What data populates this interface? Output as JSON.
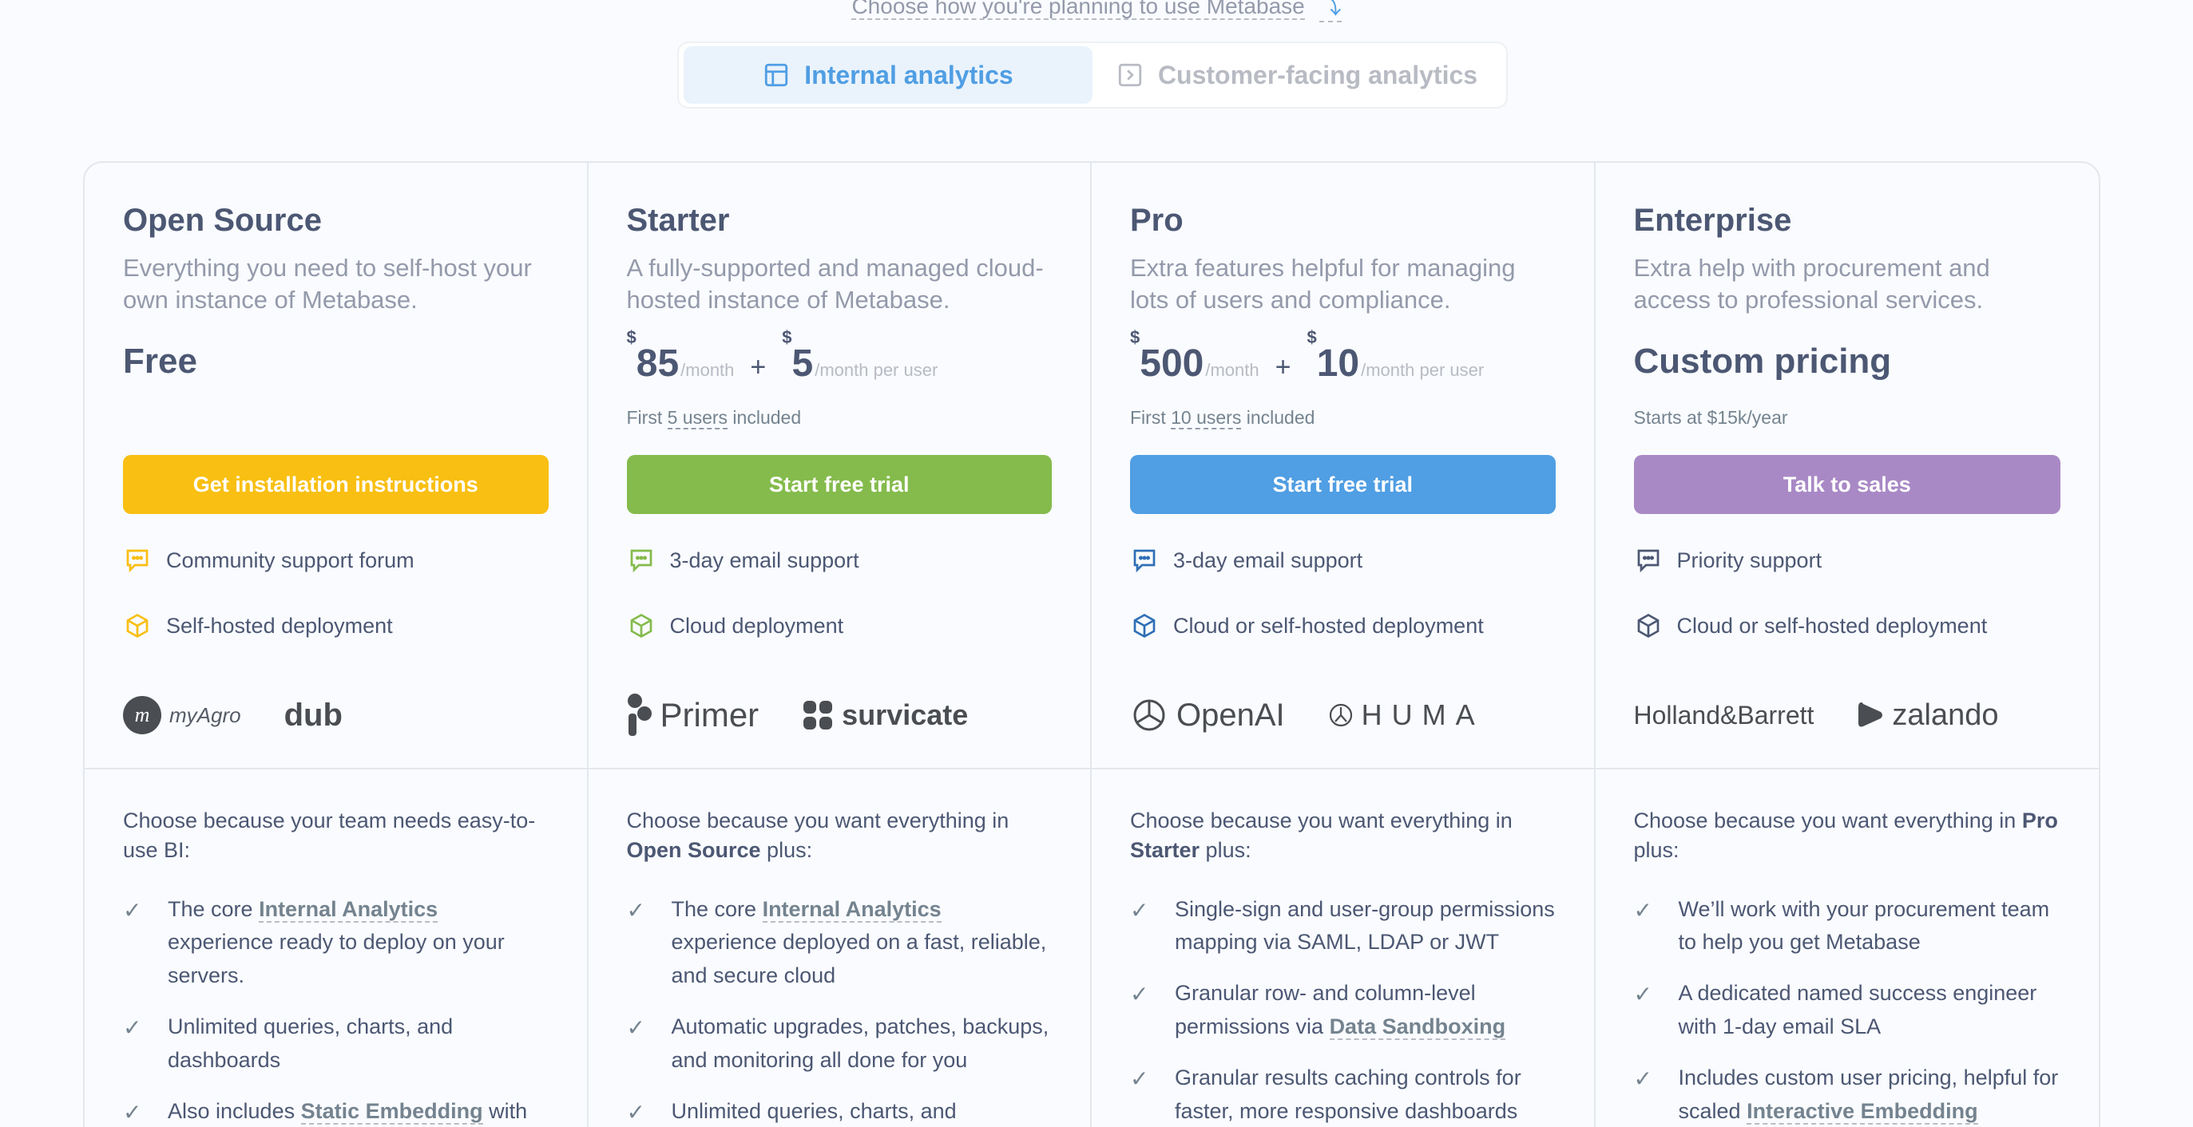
{
  "chooser": {
    "hint": "Choose how you're planning to use Metabase",
    "tabs": [
      {
        "label": "Internal analytics",
        "active": true
      },
      {
        "label": "Customer-facing analytics",
        "active": false
      }
    ]
  },
  "plans": [
    {
      "name": "Open Source",
      "description": "Everything you need to self-host your own instance of Metabase.",
      "price_label": "Free",
      "note": "",
      "cta": "Get installation instructions",
      "accent": "#F9BF12",
      "features": [
        "Community support forum",
        "Self-hosted deployment"
      ],
      "logos": [
        "myAgro",
        "dub"
      ],
      "choose_prefix": "Choose because your team needs easy-to-use BI:",
      "items": [
        {
          "pre": "The core ",
          "link": "Internal Analytics",
          "post": " experience ready to deploy on your servers."
        },
        {
          "pre": "Unlimited queries, charts, and dashboards",
          "link": "",
          "post": ""
        },
        {
          "pre": "Also includes ",
          "link": "Static Embedding",
          "post": " with the “Powered by Metabase” badge."
        }
      ]
    },
    {
      "name": "Starter",
      "description": "A fully-supported and managed cloud-hosted instance of Metabase.",
      "price": {
        "base": "85",
        "base_unit": "/month",
        "per_user": "5",
        "per_user_unit": "/month per user",
        "currency": "$"
      },
      "note": {
        "pre": "First ",
        "link": "5 users",
        "post": " included"
      },
      "cta": "Start free trial",
      "accent": "#84BB4C",
      "features": [
        "3-day email support",
        "Cloud deployment"
      ],
      "logos": [
        "Primer",
        "survicate"
      ],
      "choose_prefix": "Choose because you want everything in ",
      "choose_bold": "Open Source",
      "choose_suffix": " plus:",
      "items": [
        {
          "pre": "The core ",
          "link": "Internal Analytics",
          "post": " experience deployed on a fast, reliable, and secure cloud"
        },
        {
          "pre": "Automatic upgrades, patches, backups, and monitoring all done for you",
          "link": "",
          "post": ""
        },
        {
          "pre": "Unlimited queries, charts, and",
          "link": "",
          "post": ""
        }
      ]
    },
    {
      "name": "Pro",
      "description": "Extra features helpful for managing lots of users and compliance.",
      "price": {
        "base": "500",
        "base_unit": "/month",
        "per_user": "10",
        "per_user_unit": "/month per user",
        "currency": "$"
      },
      "note": {
        "pre": "First ",
        "link": "10 users",
        "post": " included"
      },
      "cta": "Start free trial",
      "accent": "#509EE3",
      "features": [
        "3-day email support",
        "Cloud or self-hosted deployment"
      ],
      "logos": [
        "OpenAI",
        "HUMA"
      ],
      "choose_prefix": "Choose because you want everything in ",
      "choose_bold": "Starter",
      "choose_suffix": " plus:",
      "items": [
        {
          "pre": "Single-sign and user-group permissions mapping via SAML, LDAP or JWT",
          "link": "",
          "post": ""
        },
        {
          "pre": "Granular row- and column-level permissions via ",
          "link": "Data Sandboxing",
          "post": ""
        },
        {
          "pre": "Granular results caching controls for faster, more responsive dashboards",
          "link": "",
          "post": ""
        }
      ]
    },
    {
      "name": "Enterprise",
      "description": "Extra help with procurement and access to professional services.",
      "price_label": "Custom pricing",
      "note_text": "Starts at $15k/year",
      "cta": "Talk to sales",
      "accent": "#A989C5",
      "features": [
        "Priority support",
        "Cloud or self-hosted deployment"
      ],
      "logos": [
        "Holland&Barrett",
        "zalando"
      ],
      "choose_prefix": "Choose because you want everything in ",
      "choose_bold": "Pro",
      "choose_suffix": " plus:",
      "items": [
        {
          "pre": "We’ll work with your procurement team to help you get Metabase",
          "link": "",
          "post": ""
        },
        {
          "pre": "A dedicated named success engineer with 1-day email SLA",
          "link": "",
          "post": ""
        },
        {
          "pre": "Includes custom user pricing, helpful for scaled ",
          "link": "Interactive Embedding",
          "post": ""
        }
      ]
    }
  ],
  "icons": {
    "support": "chat-bubble-icon",
    "deployment": "cube-icon",
    "check": "check-icon"
  }
}
